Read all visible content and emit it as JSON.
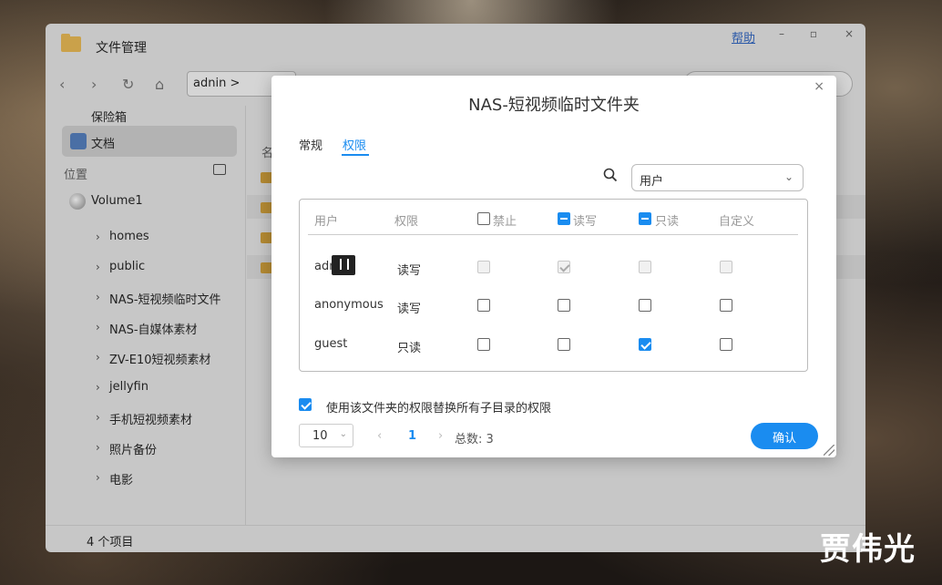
{
  "window": {
    "title": "文件管理",
    "help": "帮助",
    "controls": {
      "minimize": "–",
      "maximize": "▫",
      "close": "×"
    }
  },
  "toolbar": {
    "path": "adnin >"
  },
  "sidebar": {
    "top_items": [
      {
        "label": "保险箱"
      },
      {
        "label": "文档"
      }
    ],
    "section_label": "位置",
    "volume": "Volume1",
    "folders": [
      {
        "label": "homes"
      },
      {
        "label": "public"
      },
      {
        "label": "NAS-短视频临时文件"
      },
      {
        "label": "NAS-自媒体素材"
      },
      {
        "label": "ZV-E10短视频素材"
      },
      {
        "label": "jellyfin"
      },
      {
        "label": "手机短视频素材"
      },
      {
        "label": "照片备份"
      },
      {
        "label": "电影"
      }
    ]
  },
  "content": {
    "column_header_partial": "名"
  },
  "status": {
    "item_count": "4 个项目"
  },
  "dialog": {
    "title": "NAS-短视频临时文件夹",
    "tabs": [
      {
        "label": "常规",
        "active": false
      },
      {
        "label": "权限",
        "active": true
      }
    ],
    "filter_select": "用户",
    "table": {
      "headers": [
        "用户",
        "权限",
        "禁止",
        "读写",
        "只读",
        "自定义"
      ],
      "rows": [
        {
          "user": "adm",
          "perm": "读写",
          "deny": false,
          "rw": true,
          "ro": false,
          "custom": false,
          "disabled": true
        },
        {
          "user": "anonymous",
          "perm": "读写",
          "deny": false,
          "rw": false,
          "ro": false,
          "custom": false,
          "disabled": false
        },
        {
          "user": "guest",
          "perm": "只读",
          "deny": false,
          "rw": false,
          "ro": true,
          "custom": false,
          "disabled": false
        }
      ]
    },
    "replace_children_label": "使用该文件夹的权限替换所有子目录的权限",
    "replace_children_checked": true,
    "pagination": {
      "page_size": "10",
      "current_page": "1",
      "total": "总数: 3"
    },
    "confirm": "确认"
  },
  "watermark": "贾伟光",
  "colors": {
    "accent": "#1a8cf0",
    "window_bg": "#c7c7c7",
    "dialog_bg": "#ffffff"
  }
}
